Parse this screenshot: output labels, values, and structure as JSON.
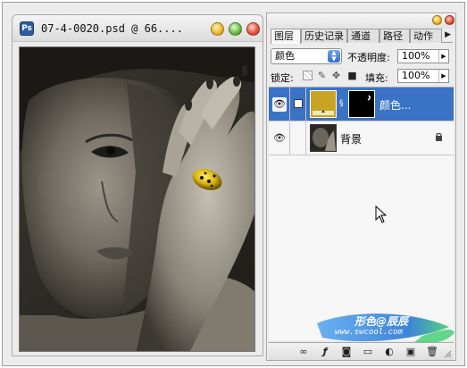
{
  "document_window": {
    "title": "07-4-0020.psd @ 66....",
    "app_icon_label": "Ps"
  },
  "layers_panel": {
    "tabs": [
      {
        "label": "图层",
        "active": true
      },
      {
        "label": "历史记录",
        "active": false
      },
      {
        "label": "通道",
        "active": false
      },
      {
        "label": "路径",
        "active": false
      },
      {
        "label": "动作",
        "active": false
      }
    ],
    "blend_mode": "颜色",
    "opacity_label": "不透明度:",
    "opacity_value": "100%",
    "lock_label": "锁定:",
    "fill_label": "填充:",
    "fill_value": "100%",
    "layers": [
      {
        "name": "颜色...",
        "selected": true,
        "has_mask": true,
        "fill_color": "#c8a422"
      },
      {
        "name": "背景",
        "selected": false,
        "locked": true
      }
    ],
    "bottom_icons": [
      "link-layers-icon",
      "layer-style-icon",
      "add-mask-icon",
      "new-group-icon",
      "adjustment-layer-icon",
      "new-layer-icon",
      "trash-icon"
    ]
  },
  "watermark": {
    "line1": "形色@辰辰",
    "line2": "www.swcool.com"
  },
  "colors": {
    "selection_blue": "#3a73c6",
    "fill_layer_gold": "#c8a422"
  }
}
